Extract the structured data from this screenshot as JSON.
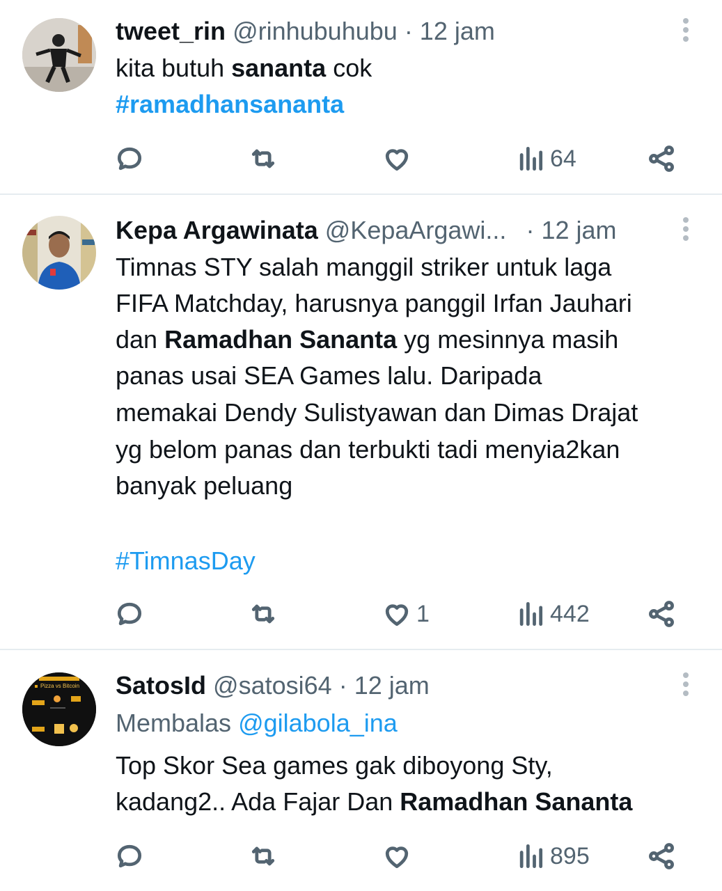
{
  "tweets": [
    {
      "name": "tweet_rin",
      "handle": "@rinhubuhubu",
      "time": "· 12 jam",
      "line1_pre": "kita butuh ",
      "line1_bold": "sananta",
      "line1_post": " cok",
      "hashtag": "#ramadhansananta",
      "views": "64"
    },
    {
      "name": "Kepa Argawinata",
      "handle": "@KepaArgawi...",
      "time": "· 12 jam",
      "lines": [
        "Timnas STY salah manggil striker untuk laga",
        "FIFA Matchday, harusnya panggil Irfan Jauhari"
      ],
      "line3_pre": "dan ",
      "line3_bold": "Ramadhan Sananta",
      "line3_post": " yg mesinnya masih",
      "lines_after": [
        "panas usai SEA Games lalu. Daripada",
        "memakai Dendy Sulistyawan dan Dimas Drajat",
        "yg belom panas dan terbukti tadi menyia2kan",
        "banyak peluang"
      ],
      "hashtag": "#TimnasDay",
      "likes": "1",
      "views": "442"
    },
    {
      "name": "SatosId",
      "handle": "@satosi64",
      "time": "· 12 jam",
      "replying_label": "Membalas",
      "replying_to": "@gilabola_ina",
      "line1": "Top Skor Sea games gak diboyong Sty,",
      "line2_pre": "kadang2.. Ada Fajar Dan ",
      "line2_bold": "Ramadhan Sananta",
      "avatar_text": "Pizza vs Bitcoin",
      "views": "895"
    }
  ],
  "icons": {
    "reply": "reply-icon",
    "retweet": "retweet-icon",
    "like": "heart-icon",
    "views": "views-chart-icon",
    "share": "share-icon",
    "more": "more-vertical-icon"
  },
  "colors": {
    "link": "#1d9bf0",
    "secondary": "#536471",
    "text": "#0f1419",
    "divider": "#e6ecf0"
  }
}
